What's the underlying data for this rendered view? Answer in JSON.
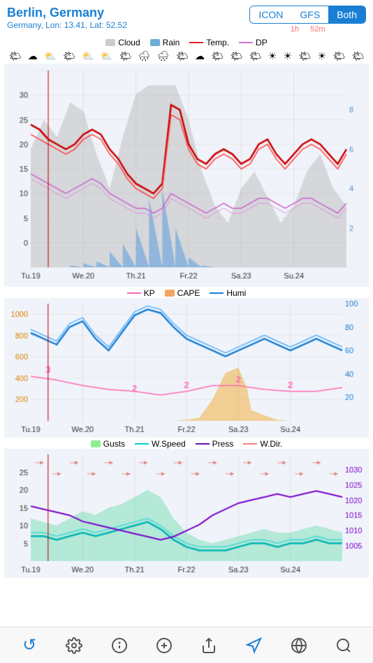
{
  "header": {
    "city": "Berlin, Germany",
    "coords": "Germany, Lon: 13.41, Lat: 52.52",
    "model_icon_label": "ICON",
    "model_gfs_label": "GFS",
    "model_both_label": "Both",
    "model_icon_time": "1h",
    "model_gfs_time": "52m"
  },
  "chart1": {
    "legend": {
      "cloud_label": "Cloud",
      "rain_label": "Rain",
      "temp_label": "Temp.",
      "dp_label": "DP"
    }
  },
  "chart2": {
    "legend": {
      "kp_label": "KP",
      "cape_label": "CAPE",
      "humi_label": "Humi"
    }
  },
  "chart3": {
    "legend": {
      "gusts_label": "Gusts",
      "wspeed_label": "W.Speed",
      "press_label": "Press",
      "wdir_label": "W.Dir."
    }
  },
  "xaxis_labels": [
    "Tu.19",
    "We.20",
    "Th.21",
    "Fr.22",
    "Sa.23",
    "Su.24"
  ],
  "toolbar": {
    "refresh_label": "↺",
    "settings_label": "⚙",
    "info_label": "ℹ",
    "add_label": "+",
    "share_label": "⬆",
    "location_label": "◎",
    "globe_label": "🌐",
    "search_label": "🔍"
  },
  "weather_icons": [
    "🌤",
    "☁",
    "⛅",
    "🌤",
    "⛅",
    "⛅",
    "🌤",
    "🌧",
    "🌧",
    "🌤",
    "☁",
    "🌤",
    "🌤",
    "🌤",
    "☀",
    "☀",
    "🌤",
    "☀",
    "🌤",
    "🌤"
  ]
}
